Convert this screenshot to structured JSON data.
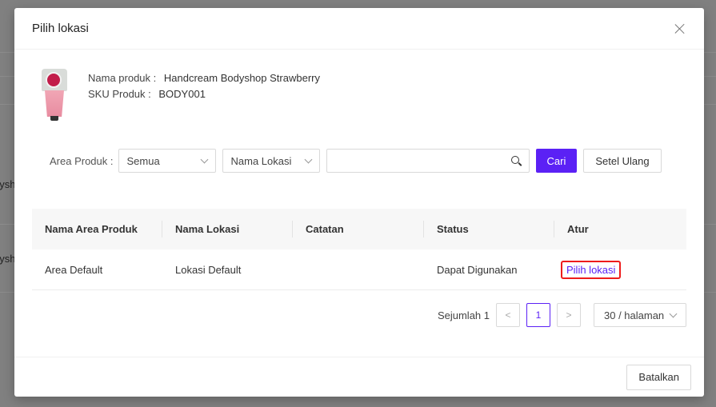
{
  "background": {
    "fragments": [
      "dysh",
      "dysh"
    ]
  },
  "modal": {
    "title": "Pilih lokasi",
    "product": {
      "name_label": "Nama produk :",
      "name_value": "Handcream Bodyshop Strawberry",
      "sku_label": "SKU Produk :",
      "sku_value": "BODY001"
    },
    "filters": {
      "area_label": "Area Produk :",
      "area_select": "Semua",
      "field_select": "Nama Lokasi",
      "search_value": "",
      "search_button": "Cari",
      "reset_button": "Setel Ulang"
    },
    "table": {
      "columns": [
        "Nama Area Produk",
        "Nama Lokasi",
        "Catatan",
        "Status",
        "Atur"
      ],
      "rows": [
        {
          "area": "Area Default",
          "location": "Lokasi Default",
          "note": "",
          "status": "Dapat Digunakan",
          "action": "Pilih lokasi"
        }
      ]
    },
    "pagination": {
      "total": "Sejumlah 1",
      "prev": "<",
      "current": "1",
      "next": ">",
      "page_size": "30 / halaman"
    },
    "footer": {
      "cancel": "Batalkan"
    }
  },
  "colors": {
    "primary": "#5b21f5",
    "highlight": "#ee1c1c"
  }
}
